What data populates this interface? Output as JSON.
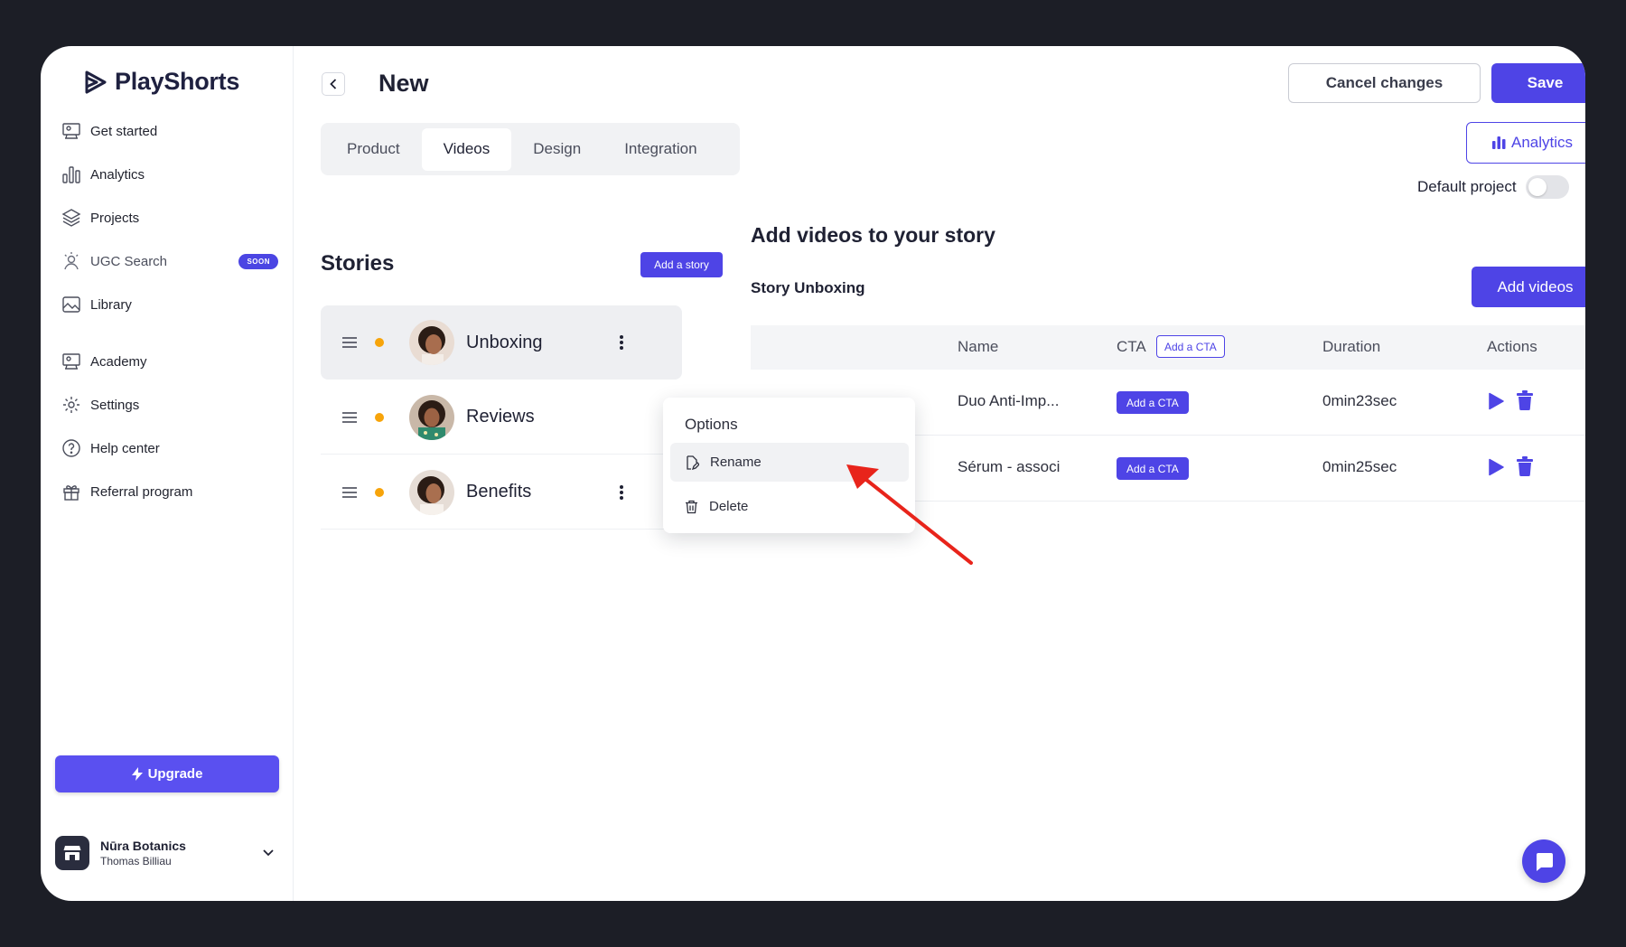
{
  "brand": {
    "name": "PlayShorts"
  },
  "sidebar": {
    "nav": [
      {
        "label": "Get started",
        "icon": "presentation-icon"
      },
      {
        "label": "Analytics",
        "icon": "bar-chart-icon"
      },
      {
        "label": "Projects",
        "icon": "layers-icon"
      },
      {
        "label": "UGC Search",
        "icon": "person-search-icon",
        "badge": "SOON"
      },
      {
        "label": "Library",
        "icon": "image-icon"
      }
    ],
    "nav2": [
      {
        "label": "Academy",
        "icon": "presentation-icon"
      },
      {
        "label": "Settings",
        "icon": "gear-icon"
      },
      {
        "label": "Help center",
        "icon": "question-circle-icon"
      },
      {
        "label": "Referral program",
        "icon": "gift-icon"
      }
    ],
    "upgrade_label": "Upgrade",
    "account": {
      "name": "Nūra Botanics",
      "user": "Thomas Billiau"
    }
  },
  "header": {
    "title": "New",
    "cancel_label": "Cancel changes",
    "save_label": "Save",
    "analytics_label": "Analytics",
    "default_project_label": "Default project",
    "default_project_on": false
  },
  "tabs": [
    {
      "label": "Product",
      "active": false
    },
    {
      "label": "Videos",
      "active": true
    },
    {
      "label": "Design",
      "active": false
    },
    {
      "label": "Integration",
      "active": false
    }
  ],
  "stories": {
    "title": "Stories",
    "add_label": "Add a story",
    "items": [
      {
        "name": "Unboxing",
        "status_color": "#f7a40a",
        "active": true
      },
      {
        "name": "Reviews",
        "status_color": "#f7a40a",
        "active": false
      },
      {
        "name": "Benefits",
        "status_color": "#f7a40a",
        "active": false
      }
    ]
  },
  "options_menu": {
    "title": "Options",
    "items": [
      {
        "label": "Rename",
        "icon": "edit-icon"
      },
      {
        "label": "Delete",
        "icon": "trash-icon"
      }
    ]
  },
  "panel": {
    "title": "Add videos to your story",
    "subtitle": "Story Unboxing",
    "add_videos_label": "Add videos",
    "columns": {
      "name": "Name",
      "cta": "CTA",
      "add_cta": "Add a CTA",
      "duration": "Duration",
      "actions": "Actions"
    },
    "rows": [
      {
        "name": "Duo Anti-Imp...",
        "cta": "Add a CTA",
        "duration": "0min23sec"
      },
      {
        "name": "Sérum - associ",
        "cta": "Add a CTA",
        "duration": "0min25sec"
      }
    ]
  },
  "colors": {
    "accent": "#4e44e6",
    "status": "#f7a40a",
    "annotation_arrow": "#e8241b"
  }
}
